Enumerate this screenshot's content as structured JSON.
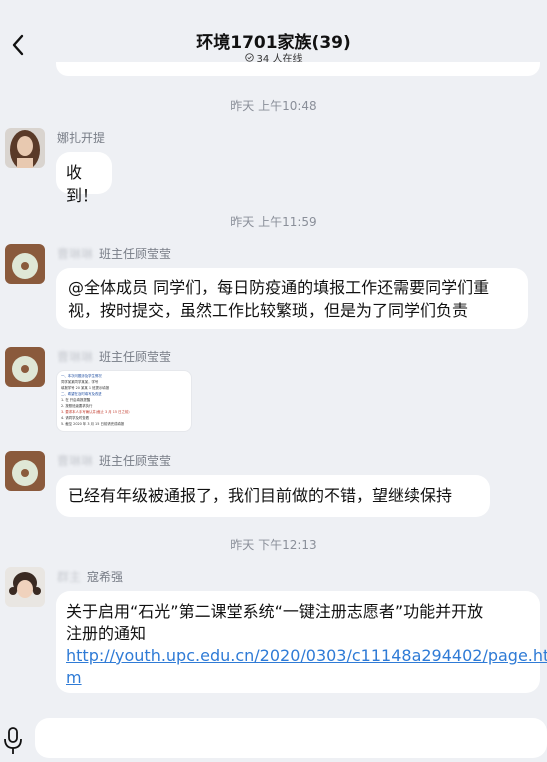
{
  "header": {
    "title": "环境1701家族(39)",
    "online": "34 人在线"
  },
  "messages": [
    {
      "time": "昨天 上午10:48"
    },
    {
      "sender": "娜扎开提",
      "text": "收到！"
    },
    {
      "time": "昨天 上午11:59"
    },
    {
      "sender_blur": "曹琳琳",
      "sender": "班主任顾莹莹",
      "text_line1": "@全体成员 同学们，每日防疫通的填报工作还需要同学们重",
      "text_line2": "视，按时提交，虽然工作比较繁琐，但是为了同学们负责"
    },
    {
      "sender_blur": "曹琳琳",
      "sender": "班主任顾莹莹",
      "image_lines": [
        "一、本次问题涉及学生情况",
        "同学某某同学某某，学号",
        "填报学号 20 某某 1 班提示填报",
        "二、希望在及时填写及改进",
        "1. 在  开启填报提醒",
        "2. 按照班级要求执行",
        "3. 要求本人手写确认并(截止 3 月 15 日之前)",
        "4. 请同学及时查看",
        "5. 截至 2020 年 3 月 15 日前请完成填报"
      ]
    },
    {
      "sender_blur": "曹琳琳",
      "sender": "班主任顾莹莹",
      "text": "已经有年级被通报了，我们目前做的不错，望继续保持"
    },
    {
      "time": "昨天 下午12:13"
    },
    {
      "sender_blur": "群主",
      "sender": "寇希强",
      "text_line1": "关于启用“石光”第二课堂系统“一键注册志愿者”功能并开放",
      "text_line2": "注册的通知",
      "link_line1": "http://youth.upc.edu.cn/2020/0303/c11148a294402/page.ht",
      "link_line2": "m"
    }
  ],
  "input": {
    "placeholder": ""
  },
  "colors": {
    "background": "#eef0f4",
    "link": "#2f7bd6",
    "time": "#8a8f99"
  }
}
